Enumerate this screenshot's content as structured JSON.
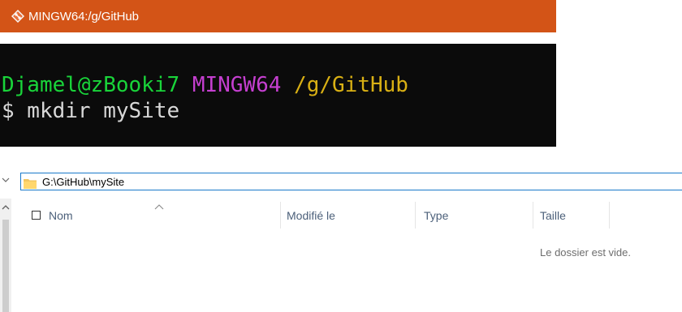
{
  "terminal": {
    "title": "MINGW64:/g/GitHub",
    "prompt": {
      "user_host": "Djamel@zBooki7",
      "env": "MINGW64",
      "path": "/g/GitHub",
      "user_color": "#19d43a",
      "env_color": "#c53fd0",
      "path_color": "#d9b014"
    },
    "command": "$ mkdir mySite",
    "titlebar_color": "#d35417"
  },
  "explorer": {
    "address": "G:\\GitHub\\mySite",
    "columns": [
      {
        "label": "Nom"
      },
      {
        "label": "Modifié le"
      },
      {
        "label": "Type"
      },
      {
        "label": "Taille"
      }
    ],
    "empty_message": "Le dossier est vide.",
    "accent_color": "#1979ca"
  }
}
